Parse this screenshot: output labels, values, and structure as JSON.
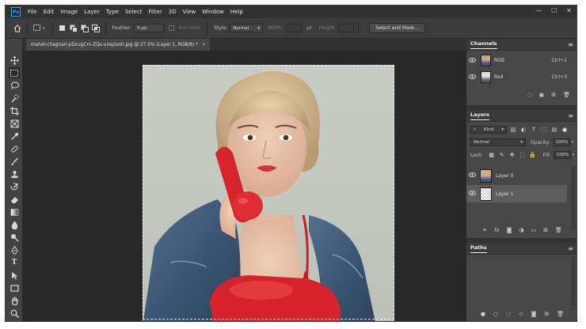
{
  "app": {
    "logo": "Ps",
    "menu": [
      "File",
      "Edit",
      "Image",
      "Layer",
      "Type",
      "Select",
      "Filter",
      "3D",
      "View",
      "Window",
      "Help"
    ],
    "window_controls": [
      "—",
      "☐",
      "✕"
    ]
  },
  "options_bar": {
    "feather_label": "Feather:",
    "feather_value": "0 px",
    "anti_alias_label": "Anti-alias",
    "style_label": "Style:",
    "style_value": "Normal",
    "width_label": "Width:",
    "height_label": "Height:",
    "select_mask_label": "Select and Mask..."
  },
  "document": {
    "tab_title": "mahdi-chaghari-pDcugCm-ZQs-unsplash.jpg @ 27.5% (Layer 1, RGB/8) *",
    "close_glyph": "×"
  },
  "channels_panel": {
    "title": "Channels",
    "channels": [
      {
        "name": "RGB",
        "shortcut": "Ctrl+2"
      },
      {
        "name": "Red",
        "shortcut": "Ctrl+3"
      }
    ]
  },
  "layers_panel": {
    "title": "Layers",
    "kind_label": "Kind",
    "blend_mode": "Normal",
    "opacity_label": "Opacity:",
    "opacity_value": "100%",
    "lock_label": "Lock:",
    "fill_label": "Fill:",
    "fill_value": "100%",
    "layers": [
      {
        "name": "Layer 0",
        "selected": false
      },
      {
        "name": "Layer 1",
        "selected": true
      }
    ]
  },
  "paths_panel": {
    "title": "Paths"
  },
  "icons": {
    "home": "home-icon",
    "marquee": "rect-marquee-icon",
    "move": "move-icon",
    "lasso": "lasso-icon",
    "crop": "crop-icon",
    "eyedropper": "eyedropper-icon",
    "brush": "brush-icon",
    "eye": "eye-icon",
    "hand": "hand-icon",
    "zoom": "zoom-icon"
  },
  "colors": {
    "accent": "#31a8ff",
    "ui_dark": "#323232",
    "ui_panel": "#474747",
    "canvas_bg": "#282828",
    "fg_swatch": "#000000",
    "bg_swatch": "#ffffff"
  }
}
